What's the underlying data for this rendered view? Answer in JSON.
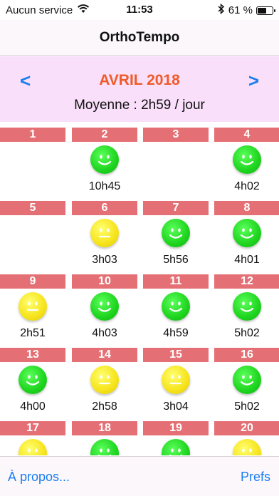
{
  "status_bar": {
    "carrier": "Aucun service",
    "time": "11:53",
    "battery": "61 %",
    "battery_level": 0.61,
    "icons": [
      "wifi-icon",
      "bluetooth-icon",
      "battery-icon"
    ]
  },
  "nav": {
    "title": "OrthoTempo"
  },
  "month": {
    "prev_label": "<",
    "next_label": ">",
    "title": "AVRIL 2018",
    "average": "Moyenne : 2h59 / jour"
  },
  "days": [
    {
      "day": "1",
      "mood": "",
      "duration": ""
    },
    {
      "day": "2",
      "mood": "green",
      "duration": "10h45"
    },
    {
      "day": "3",
      "mood": "",
      "duration": ""
    },
    {
      "day": "4",
      "mood": "green",
      "duration": "4h02"
    },
    {
      "day": "5",
      "mood": "",
      "duration": ""
    },
    {
      "day": "6",
      "mood": "yellow",
      "duration": "3h03"
    },
    {
      "day": "7",
      "mood": "green",
      "duration": "5h56"
    },
    {
      "day": "8",
      "mood": "green",
      "duration": "4h01"
    },
    {
      "day": "9",
      "mood": "yellow",
      "duration": "2h51"
    },
    {
      "day": "10",
      "mood": "green",
      "duration": "4h03"
    },
    {
      "day": "11",
      "mood": "green",
      "duration": "4h59"
    },
    {
      "day": "12",
      "mood": "green",
      "duration": "5h02"
    },
    {
      "day": "13",
      "mood": "green",
      "duration": "4h00"
    },
    {
      "day": "14",
      "mood": "yellow",
      "duration": "2h58"
    },
    {
      "day": "15",
      "mood": "yellow",
      "duration": "3h04"
    },
    {
      "day": "16",
      "mood": "green",
      "duration": "5h02"
    },
    {
      "day": "17",
      "mood": "yellow",
      "duration": ""
    },
    {
      "day": "18",
      "mood": "green",
      "duration": ""
    },
    {
      "day": "19",
      "mood": "green",
      "duration": ""
    },
    {
      "day": "20",
      "mood": "yellow",
      "duration": ""
    }
  ],
  "colors": {
    "accent": "#1a7df0",
    "month_title": "#f05a28",
    "day_header": "#e47075",
    "header_bg": "#f9dff9",
    "green": "#1ed41e",
    "yellow": "#f6e31a"
  },
  "bottom": {
    "about_label": "À propos...",
    "prefs_label": "Prefs"
  }
}
